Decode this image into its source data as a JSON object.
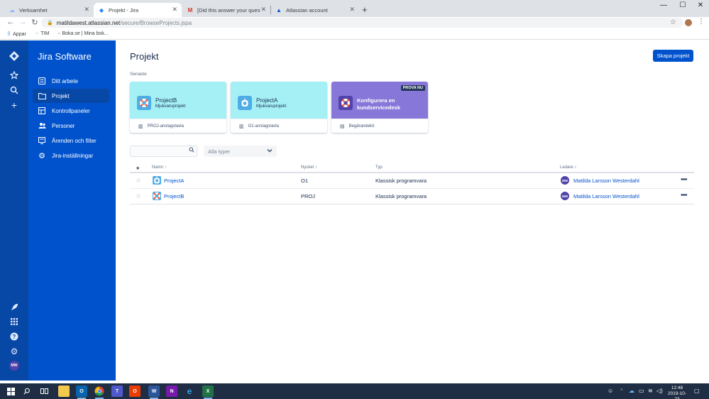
{
  "browser": {
    "tabs": [
      {
        "title": "Verksamhet",
        "favicon": "cloud-icon"
      },
      {
        "title": "Projekt - Jira",
        "favicon": "jira-icon"
      },
      {
        "title": "[Did this answer your question?]",
        "favicon": "gmail-icon"
      },
      {
        "title": "Atlassian account",
        "favicon": "atlassian-icon"
      }
    ],
    "url_host": "matildawest.atlassian.net",
    "url_path": "/secure/BrowseProjects.jspa",
    "bookmarks": [
      {
        "label": "Appar"
      },
      {
        "label": "TIM"
      },
      {
        "label": "Boka.se | Mina bok..."
      }
    ]
  },
  "sidebar": {
    "product_title": "Jira Software",
    "items": [
      {
        "label": "Ditt arbete",
        "icon": "list-icon"
      },
      {
        "label": "Projekt",
        "icon": "folder-icon",
        "selected": true
      },
      {
        "label": "Kontrollpaneler",
        "icon": "dashboard-icon"
      },
      {
        "label": "Personer",
        "icon": "people-icon"
      },
      {
        "label": "Ärenden och filter",
        "icon": "filter-icon"
      },
      {
        "label": "Jira-inställningar",
        "icon": "gear-icon"
      }
    ],
    "user_initials": "MW"
  },
  "main": {
    "title": "Projekt",
    "create_label": "Skapa projekt",
    "recent_label": "Senaste",
    "cards": [
      {
        "name": "ProjectB",
        "type": "Mjukvaruprojekt",
        "board": "PROJ-anslagstavla",
        "color": "#A5F0F5"
      },
      {
        "name": "ProjectA",
        "type": "Mjukvaruprojekt",
        "board": "O1-anslagstavla",
        "color": "#A5F0F5"
      }
    ],
    "promo": {
      "lozenge": "PROVA NU",
      "title": "Konfigurera en kundservicedesk",
      "link": "Begärandekö",
      "color": "#8777D9"
    },
    "search_placeholder": "",
    "filter_label": "Alla typer",
    "table": {
      "headers": {
        "star": "★",
        "name": "Namn ↑",
        "key": "Nyckel ↕",
        "type": "Typ",
        "lead": "Ledare ↕"
      },
      "rows": [
        {
          "name": "ProjectA",
          "key": "O1",
          "type": "Klassisk programvara",
          "lead": "Matilda Larsson Westerdahl",
          "lead_initials": "MW"
        },
        {
          "name": "ProjectB",
          "key": "PROJ",
          "type": "Klassisk programvara",
          "lead": "Matilda Larsson Westerdahl",
          "lead_initials": "MW"
        }
      ]
    }
  },
  "taskbar": {
    "time": "12:48",
    "date": "2019-10-23"
  },
  "colors": {
    "global_nav": "#0747A6",
    "project_nav": "#0052CC",
    "primary": "#0052CC"
  }
}
